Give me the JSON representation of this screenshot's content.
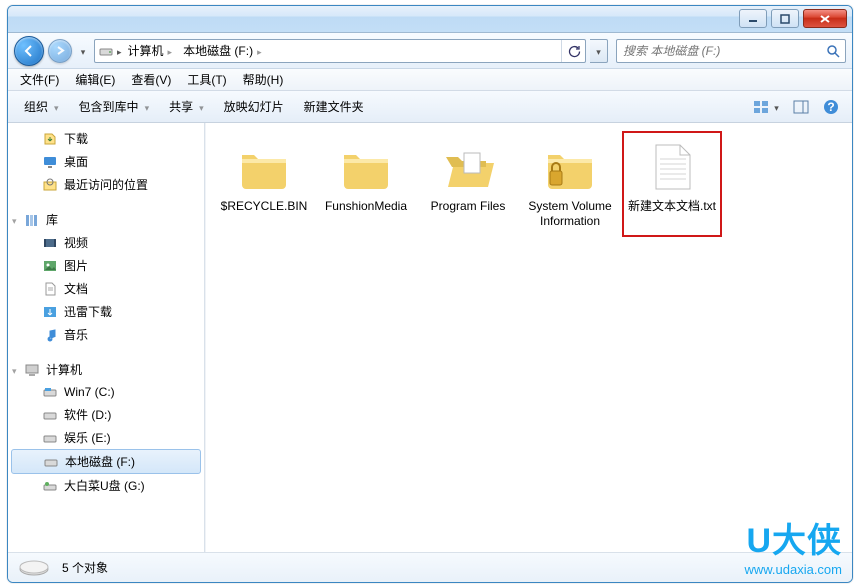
{
  "breadcrumb": {
    "seg0": "计算机",
    "seg1": "本地磁盘 (F:)"
  },
  "search": {
    "placeholder": "搜索 本地磁盘 (F:)"
  },
  "menu": {
    "file": "文件(F)",
    "edit": "编辑(E)",
    "view": "查看(V)",
    "tools": "工具(T)",
    "help": "帮助(H)"
  },
  "toolbar": {
    "organize": "组织",
    "include": "包含到库中",
    "share": "共享",
    "slideshow": "放映幻灯片",
    "newfolder": "新建文件夹"
  },
  "sidebar": {
    "fav": {
      "downloads": "下载",
      "desktop": "桌面",
      "recent": "最近访问的位置"
    },
    "lib": {
      "head": "库",
      "video": "视频",
      "pictures": "图片",
      "documents": "文档",
      "xunlei": "迅雷下载",
      "music": "音乐"
    },
    "comp": {
      "head": "计算机",
      "c": "Win7 (C:)",
      "d": "软件 (D:)",
      "e": "娱乐 (E:)",
      "f": "本地磁盘 (F:)",
      "g": "大白菜U盘 (G:)"
    }
  },
  "items": {
    "recycle": "$RECYCLE.BIN",
    "funshion": "FunshionMedia",
    "program": "Program Files",
    "system": "System Volume Information",
    "newtxt": "新建文本文档.txt"
  },
  "status": {
    "count": "5 个对象"
  },
  "watermark": {
    "title": "U大侠",
    "url": "www.udaxia.com"
  }
}
